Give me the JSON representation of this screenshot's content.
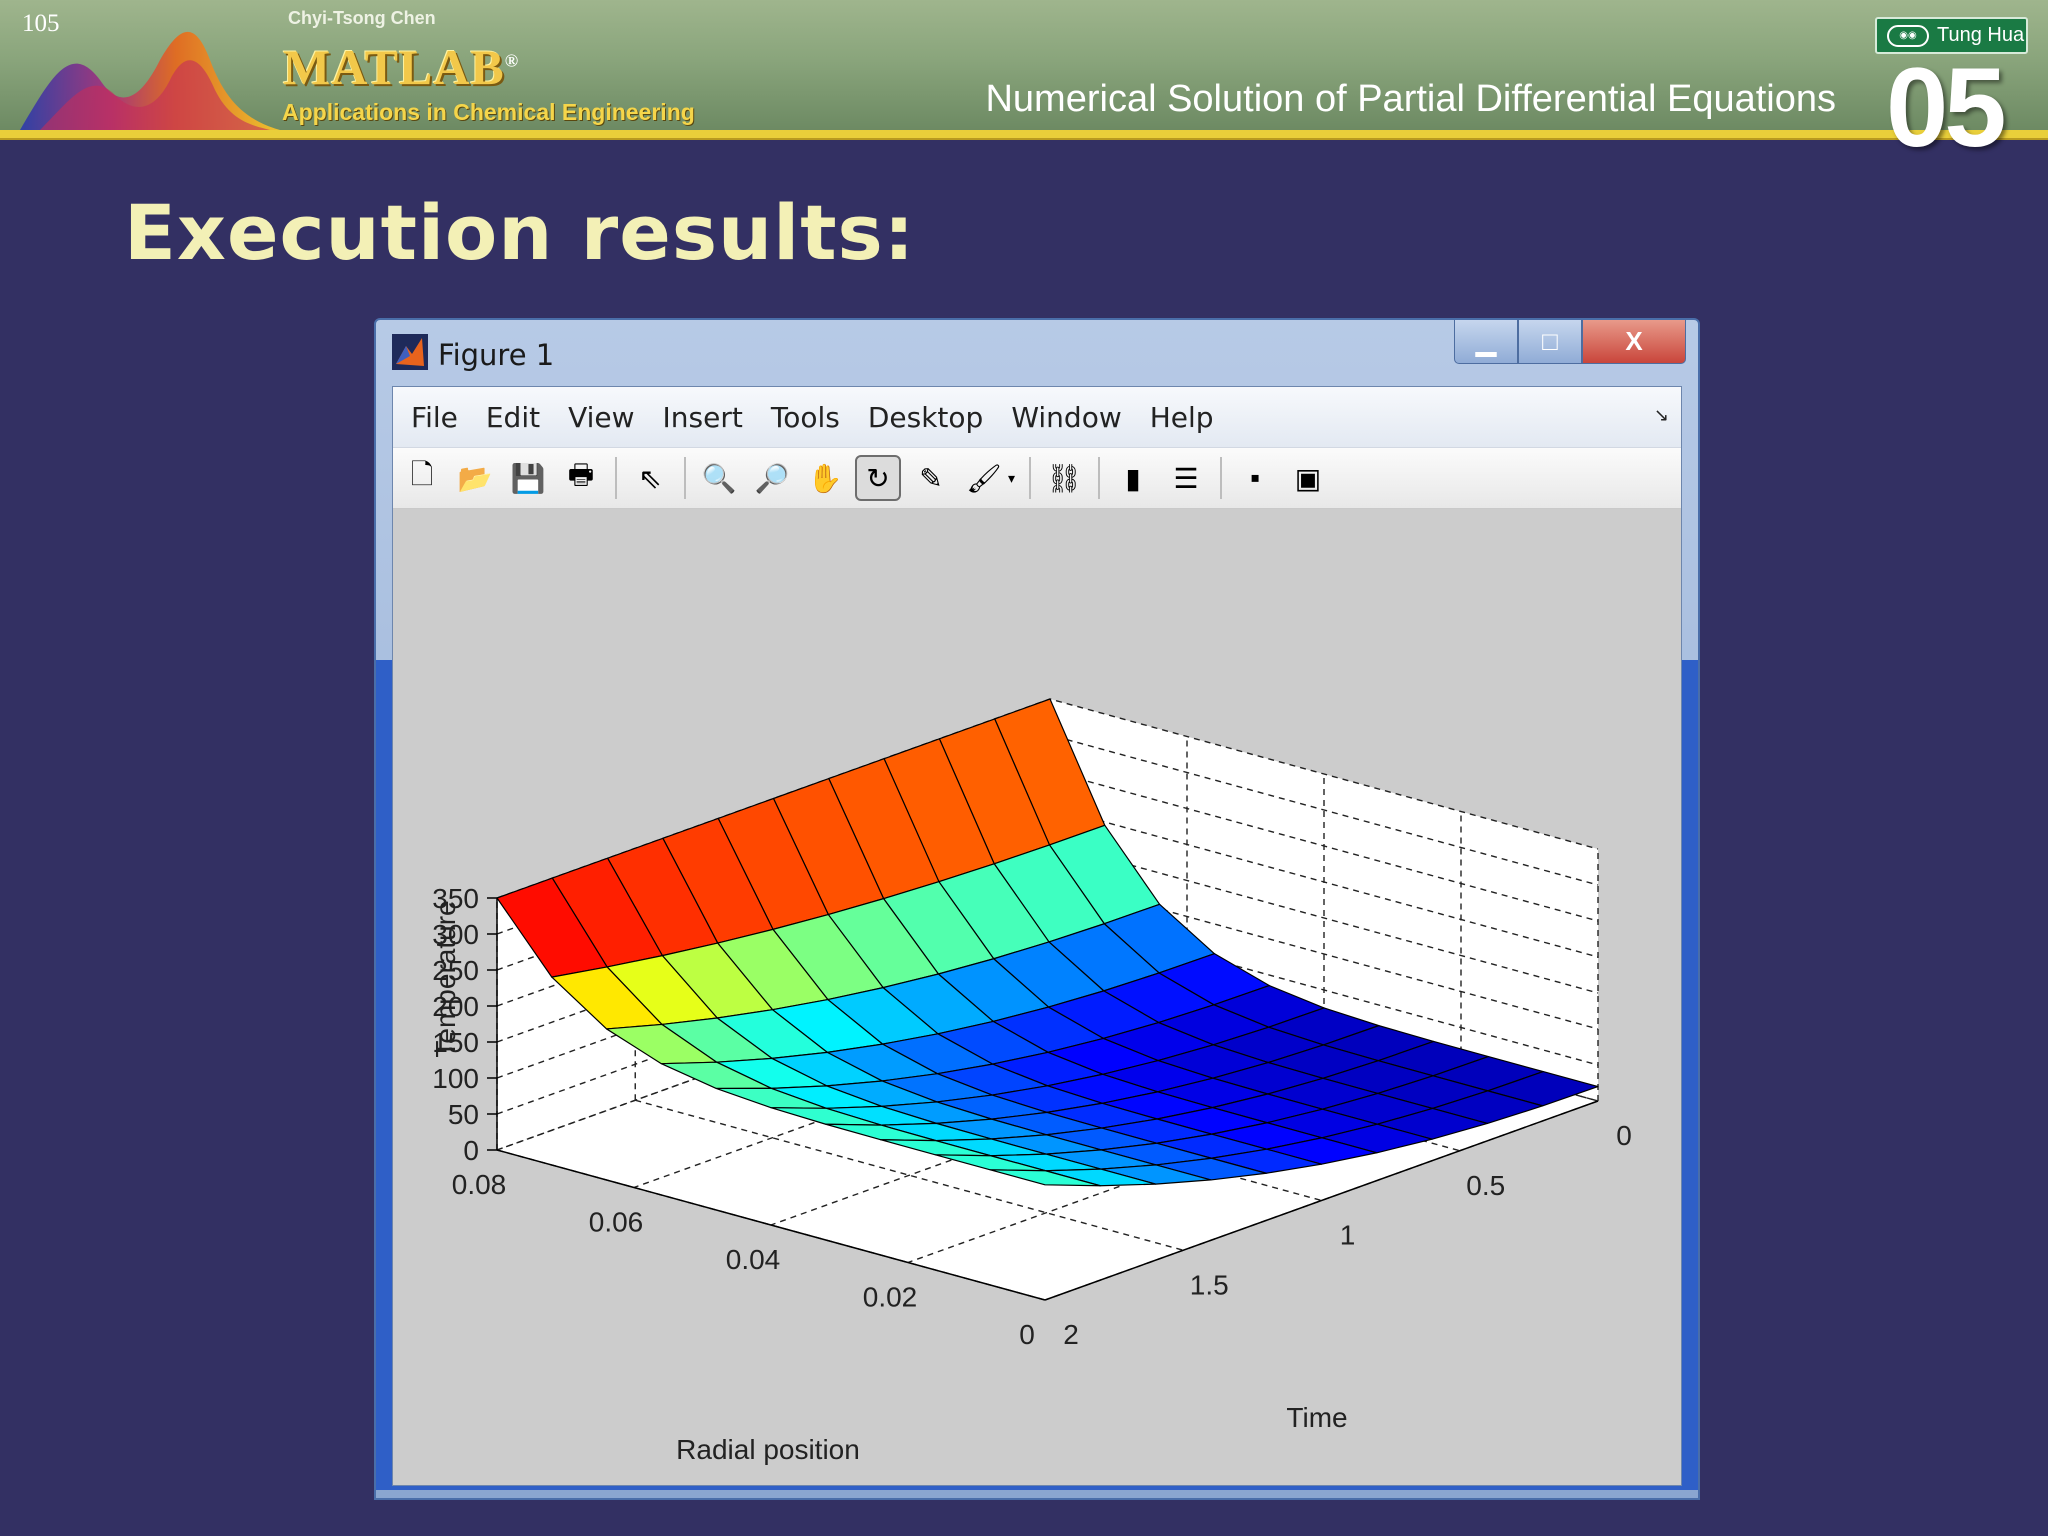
{
  "slide": {
    "page_number": "105",
    "author": "Chyi-Tsong Chen",
    "logo_text": "MATLAB",
    "logo_mark": "®",
    "book_subtitle": "Applications in Chemical Engineering",
    "chapter_title": "Numerical Solution of Partial Differential Equations",
    "chapter_number": "05",
    "publisher": "Tung Hua",
    "heading": "Execution results:"
  },
  "window": {
    "title": "Figure 1",
    "buttons": {
      "minimize": "▁",
      "maximize": "□",
      "close": "X"
    },
    "menu": [
      "File",
      "Edit",
      "View",
      "Insert",
      "Tools",
      "Desktop",
      "Window",
      "Help"
    ],
    "toolbar_icons": [
      "new-figure-icon",
      "open-file-icon",
      "save-icon",
      "print-icon",
      "edit-plot-arrow-icon",
      "zoom-in-icon",
      "zoom-out-icon",
      "pan-hand-icon",
      "rotate-3d-icon",
      "data-cursor-icon",
      "brush-icon",
      "link-plot-icon",
      "insert-colorbar-icon",
      "insert-legend-icon",
      "hide-plot-tools-icon",
      "show-plot-tools-icon"
    ]
  },
  "chart_data": {
    "type": "surface",
    "title": "",
    "xlabel": "Radial position",
    "ylabel": "Time",
    "zlabel": "Temperature",
    "x_ticks": [
      "0",
      "0.02",
      "0.04",
      "0.06",
      "0.08"
    ],
    "y_ticks": [
      "0",
      "0.5",
      "1",
      "1.5",
      "2"
    ],
    "z_ticks": [
      "0",
      "50",
      "100",
      "150",
      "200",
      "250",
      "300",
      "350"
    ],
    "xlim": [
      0,
      0.08
    ],
    "ylim": [
      0,
      2
    ],
    "zlim": [
      0,
      350
    ],
    "grid": true,
    "colormap": "jet",
    "grid_size": {
      "radial_points": 11,
      "time_points": 11
    },
    "surface_description_values": {
      "radial_position": [
        0,
        0.008,
        0.016,
        0.024,
        0.032,
        0.04,
        0.048,
        0.056,
        0.064,
        0.072,
        0.08
      ],
      "time": [
        0,
        0.2,
        0.4,
        0.6,
        0.8,
        1.0,
        1.2,
        1.4,
        1.6,
        1.8,
        2.0
      ],
      "temperature_at_outer_radius_vs_time": [
        350,
        350,
        350,
        350,
        350,
        350,
        350,
        350,
        350,
        350,
        350
      ],
      "temperature_at_center_vs_time": [
        20,
        20,
        21,
        24,
        30,
        40,
        55,
        75,
        100,
        130,
        160
      ]
    }
  }
}
